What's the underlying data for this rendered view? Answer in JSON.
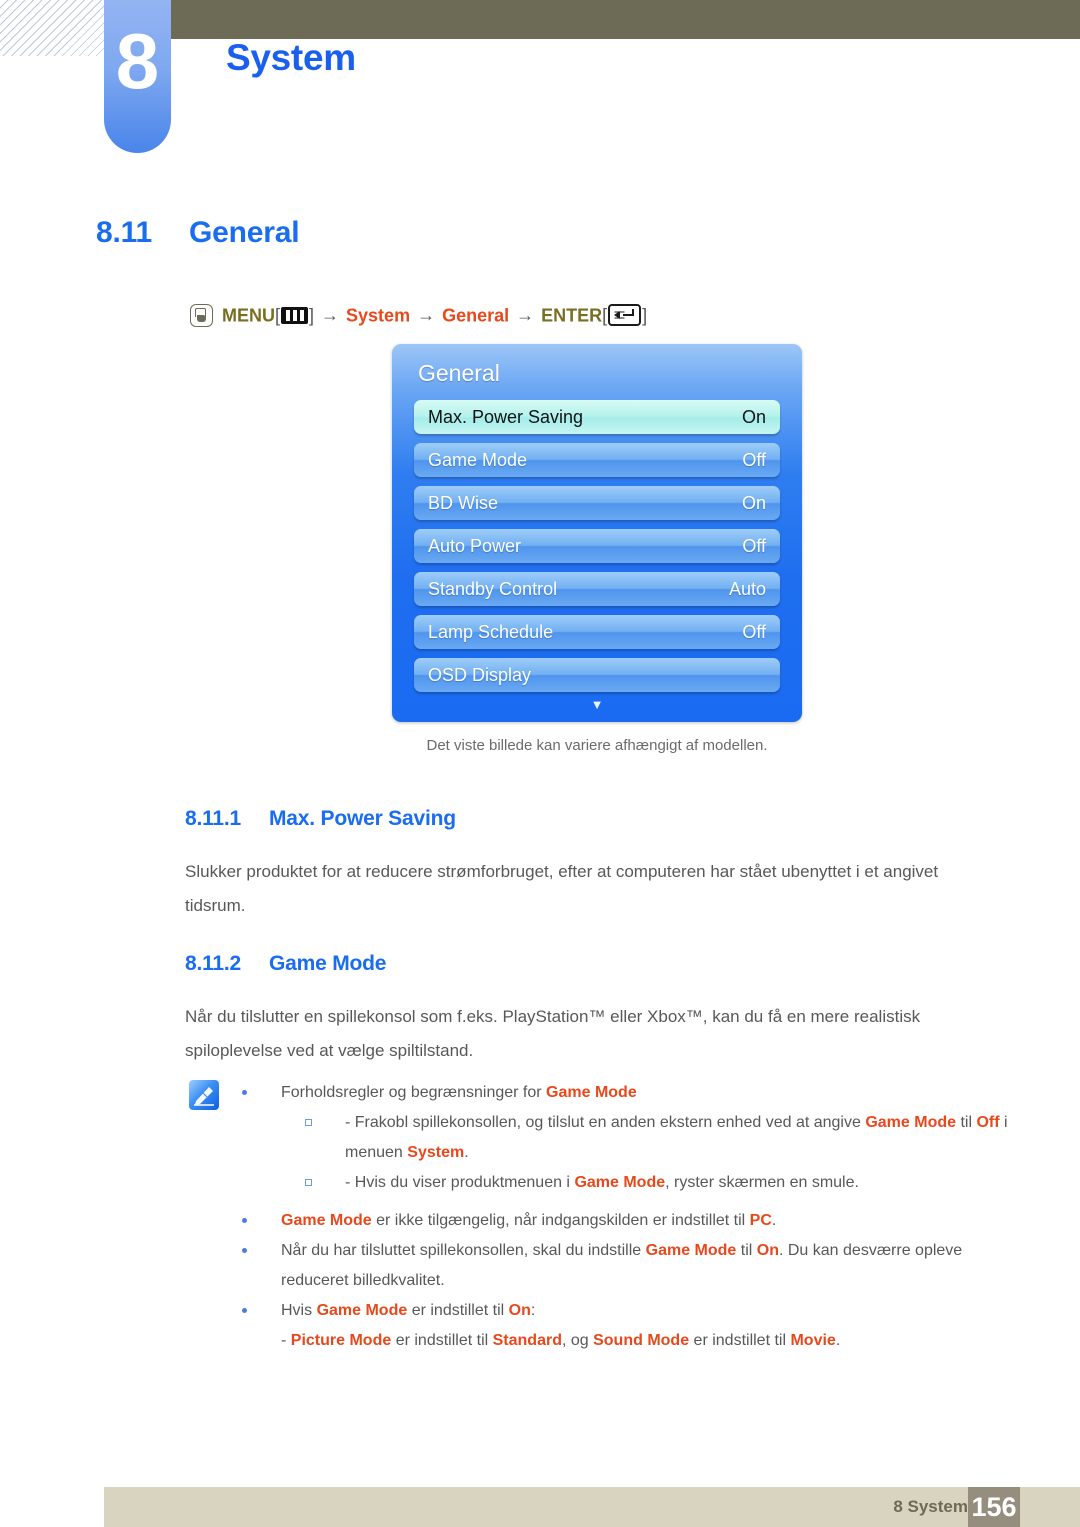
{
  "chapter": {
    "number": "8",
    "title": "System"
  },
  "section": {
    "number": "8.11",
    "title": "General"
  },
  "breadcrumb": {
    "menu_label": "MENU",
    "bracket_open": "[",
    "bracket_close": "]",
    "arrow": "→",
    "item1": "System",
    "item2": "General",
    "enter_label": "ENTER",
    "hand_icon": "hand-press-icon",
    "menu_icon": "menu-bars-icon",
    "enter_icon": "enter-return-icon"
  },
  "osd": {
    "title": "General",
    "rows": [
      {
        "label": "Max. Power Saving",
        "value": "On",
        "selected": true
      },
      {
        "label": "Game Mode",
        "value": "Off",
        "selected": false
      },
      {
        "label": "BD Wise",
        "value": "On",
        "selected": false
      },
      {
        "label": "Auto Power",
        "value": "Off",
        "selected": false
      },
      {
        "label": "Standby Control",
        "value": "Auto",
        "selected": false
      },
      {
        "label": "Lamp Schedule",
        "value": "Off",
        "selected": false
      },
      {
        "label": "OSD Display",
        "value": "",
        "selected": false
      }
    ],
    "scroll_caret": "▼",
    "caption": "Det viste billede kan variere afhængigt af modellen."
  },
  "sub1": {
    "number": "8.11.1",
    "title": "Max. Power Saving",
    "body": "Slukker produktet for at reducere strømforbruget, efter at computeren har stået ubenyttet i et angivet tidsrum."
  },
  "sub2": {
    "number": "8.11.2",
    "title": "Game Mode",
    "body": "Når du tilslutter en spillekonsol som f.eks. PlayStation™ eller Xbox™, kan du få en mere realistisk spiloplevelse ved at vælge spiltilstand."
  },
  "note": {
    "icon": "note-pen-icon",
    "bullet1": {
      "pre": "Forholdsregler og begrænsninger for ",
      "term": "Game Mode"
    },
    "sub_a": {
      "p1": "- Frakobl spillekonsollen, og tilslut en anden ekstern enhed ved at angive ",
      "t1": "Game Mode",
      "p2": " til ",
      "t2": "Off",
      "p3": " i menuen ",
      "t3": "System",
      "p4": "."
    },
    "sub_b": {
      "p1": "- Hvis du viser produktmenuen i ",
      "t1": "Game Mode",
      "p2": ", ryster skærmen en smule."
    },
    "bullet2": {
      "t1": "Game Mode",
      "p1": " er ikke tilgængelig, når indgangskilden er indstillet til ",
      "t2": "PC",
      "p2": "."
    },
    "bullet3": {
      "p1": "Når du har tilsluttet spillekonsollen, skal du indstille ",
      "t1": "Game Mode",
      "p2": " til ",
      "t2": "On",
      "p3": ". Du kan desværre opleve reduceret billedkvalitet."
    },
    "bullet4": {
      "p1": "Hvis ",
      "t1": "Game Mode",
      "p2": " er indstillet til ",
      "t2": "On",
      "p3": ":"
    },
    "bullet4_sub": {
      "p1": "- ",
      "t1": "Picture Mode",
      "p2": " er indstillet til ",
      "t2": "Standard",
      "p3": ", og ",
      "t3": "Sound Mode",
      "p4": " er indstillet til ",
      "t4": "Movie",
      "p5": "."
    }
  },
  "footer": {
    "label": "8 System",
    "page": "156"
  },
  "colors": {
    "heading_blue": "#1a6cf0",
    "accent_red": "#e8491c",
    "olive": "#7a6f21",
    "topbar": "#6d6a56",
    "footer_bar": "#d9d4c0",
    "footer_page": "#958d7d"
  }
}
